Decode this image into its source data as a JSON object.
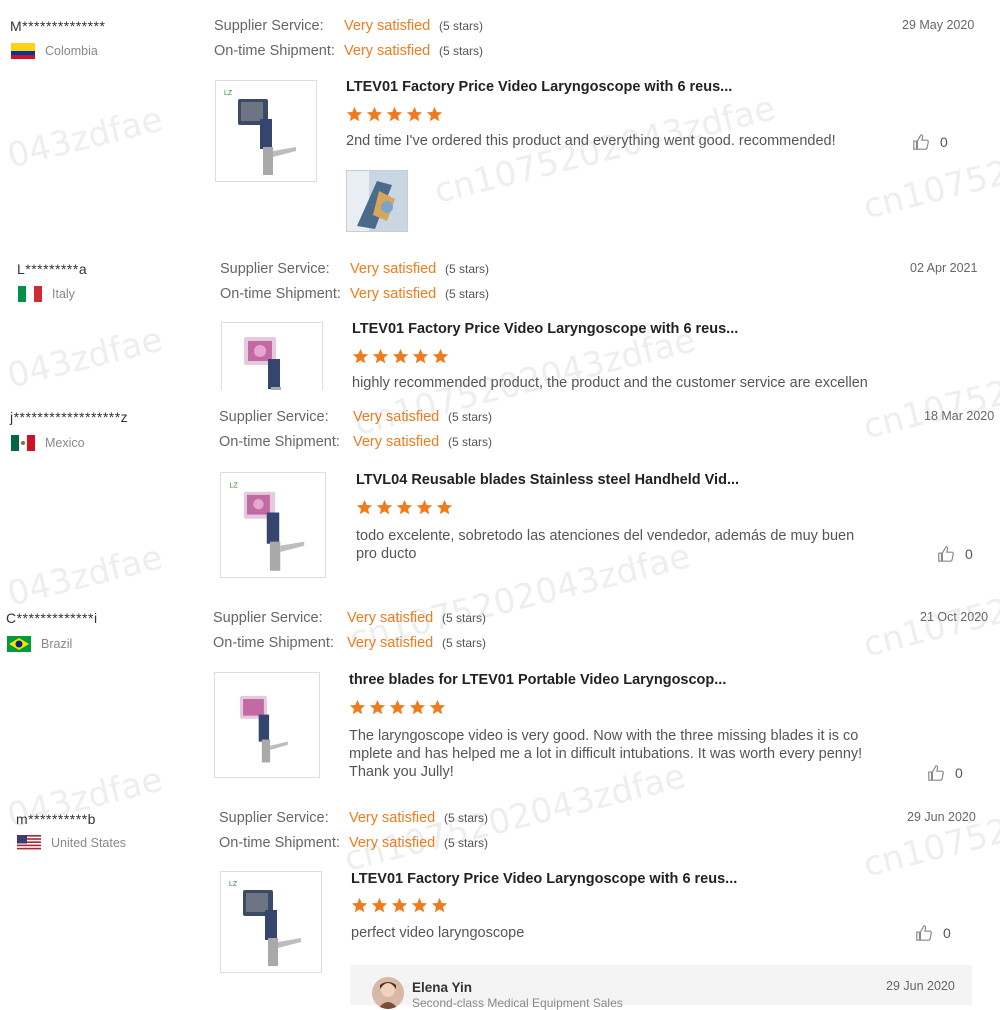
{
  "labels": {
    "supplier_service": "Supplier Service:",
    "ontime_shipment": "On-time Shipment:"
  },
  "colors": {
    "accent": "#f07b1d",
    "star": "#f07b1d"
  },
  "reviews": [
    {
      "user": "M**************",
      "country": "Colombia",
      "flag": "colombia-flag-icon",
      "supplier_rating": "Very satisfied",
      "supplier_stars": "(5 stars)",
      "shipment_rating": "Very satisfied",
      "shipment_stars": "(5 stars)",
      "date": "29 May 2020",
      "product": "LTEV01 Factory Price Video Laryngoscope with 6 reus...",
      "stars": 5,
      "text": "2nd time I've ordered this product and everything went good. recommended!",
      "likes": "0"
    },
    {
      "user": "L*********a",
      "country": "Italy",
      "flag": "italy-flag-icon",
      "supplier_rating": "Very satisfied",
      "supplier_stars": "(5 stars)",
      "shipment_rating": "Very satisfied",
      "shipment_stars": "(5 stars)",
      "date": "02 Apr 2021",
      "product": "LTEV01 Factory Price Video Laryngoscope with 6 reus...",
      "stars": 5,
      "text": "highly recommended product, the product and the customer service are excellen",
      "likes": ""
    },
    {
      "user": "j******************z",
      "country": "Mexico",
      "flag": "mexico-flag-icon",
      "supplier_rating": "Very satisfied",
      "supplier_stars": "(5 stars)",
      "shipment_rating": "Very satisfied",
      "shipment_stars": "(5 stars)",
      "date": "18 Mar 2020",
      "product": "LTVL04 Reusable blades Stainless steel Handheld Vid...",
      "stars": 5,
      "text": "todo excelente, sobretodo las atenciones del vendedor, además de muy buen pro ducto",
      "likes": "0"
    },
    {
      "user": "C*************i",
      "country": "Brazil",
      "flag": "brazil-flag-icon",
      "supplier_rating": "Very satisfied",
      "supplier_stars": "(5 stars)",
      "shipment_rating": "Very satisfied",
      "shipment_stars": "(5 stars)",
      "date": "21 Oct 2020",
      "product": "three blades for LTEV01 Portable Video Laryngoscop...",
      "stars": 5,
      "text": "The laryngoscope video is very good.  Now with the three missing blades it is co mplete and has helped me a lot in difficult intubations. It was worth every penny! Thank you Jully!",
      "likes": "0"
    },
    {
      "user": "m**********b",
      "country": "United States",
      "flag": "usa-flag-icon",
      "supplier_rating": "Very satisfied",
      "supplier_stars": "(5 stars)",
      "shipment_rating": "Very satisfied",
      "shipment_stars": "(5 stars)",
      "date": "29 Jun 2020",
      "product": "LTEV01 Factory Price Video Laryngoscope with 6 reus...",
      "stars": 5,
      "text": "perfect video laryngoscope",
      "likes": "0"
    }
  ],
  "reply": {
    "name": "Elena Yin",
    "subtitle": "Second-class Medical Equipment Sales",
    "date": "29 Jun 2020"
  },
  "watermarks": [
    "043zdfae",
    "cn1075202043zdfae",
    "cn10752"
  ]
}
